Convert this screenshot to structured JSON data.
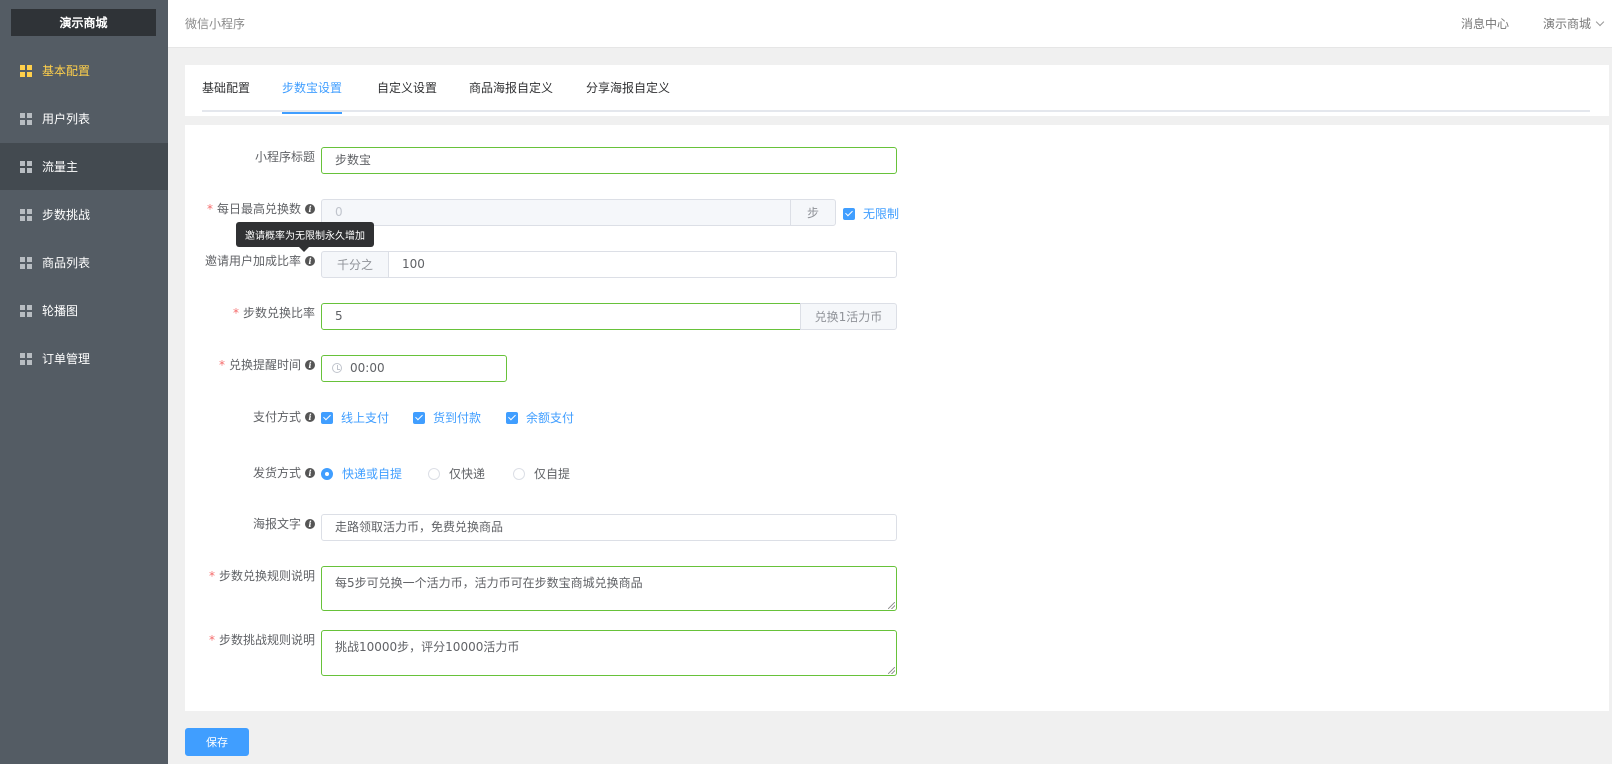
{
  "sidebar": {
    "brand": "演示商城",
    "items": [
      {
        "label": "基本配置"
      },
      {
        "label": "用户列表"
      },
      {
        "label": "流量主"
      },
      {
        "label": "步数挑战"
      },
      {
        "label": "商品列表"
      },
      {
        "label": "轮播图"
      },
      {
        "label": "订单管理"
      }
    ]
  },
  "header": {
    "breadcrumb": "微信小程序",
    "messages": "消息中心",
    "user": "演示商城"
  },
  "tabs": [
    {
      "label": "基础配置"
    },
    {
      "label": "步数宝设置"
    },
    {
      "label": "自定义设置"
    },
    {
      "label": "商品海报自定义"
    },
    {
      "label": "分享海报自定义"
    }
  ],
  "form": {
    "title": {
      "label": "小程序标题",
      "value": "步数宝"
    },
    "daily_max": {
      "label": "每日最高兑换数",
      "placeholder": "0",
      "suffix": "步",
      "unlimited": "无限制"
    },
    "tooltip": "邀请概率为无限制永久增加",
    "invite_rate": {
      "label": "邀请用户加成比率",
      "prefix": "千分之",
      "value": "100"
    },
    "exchange_rate": {
      "label": "步数兑换比率",
      "value": "5",
      "suffix": "兑换1活力币"
    },
    "reminder": {
      "label": "兑换提醒时间",
      "value": "00:00"
    },
    "payment": {
      "label": "支付方式",
      "options": [
        "线上支付",
        "货到付款",
        "余额支付"
      ]
    },
    "delivery": {
      "label": "发货方式",
      "options": [
        "快递或自提",
        "仅快递",
        "仅自提"
      ],
      "selected": "快递或自提"
    },
    "poster_text": {
      "label": "海报文字",
      "value": "走路领取活力币，免费兑换商品"
    },
    "exchange_rules": {
      "label": "步数兑换规则说明",
      "value": "每5步可兑换一个活力币，活力币可在步数宝商城兑换商品"
    },
    "challenge_rules": {
      "label": "步数挑战规则说明",
      "value": "挑战10000步，评分10000活力币"
    },
    "save": "保存"
  },
  "colors": {
    "sidebar_bg": "#545c64",
    "active_nav": "#ffd04b",
    "primary": "#409eff",
    "success_border": "#67c23a",
    "required": "#f56c6c"
  }
}
